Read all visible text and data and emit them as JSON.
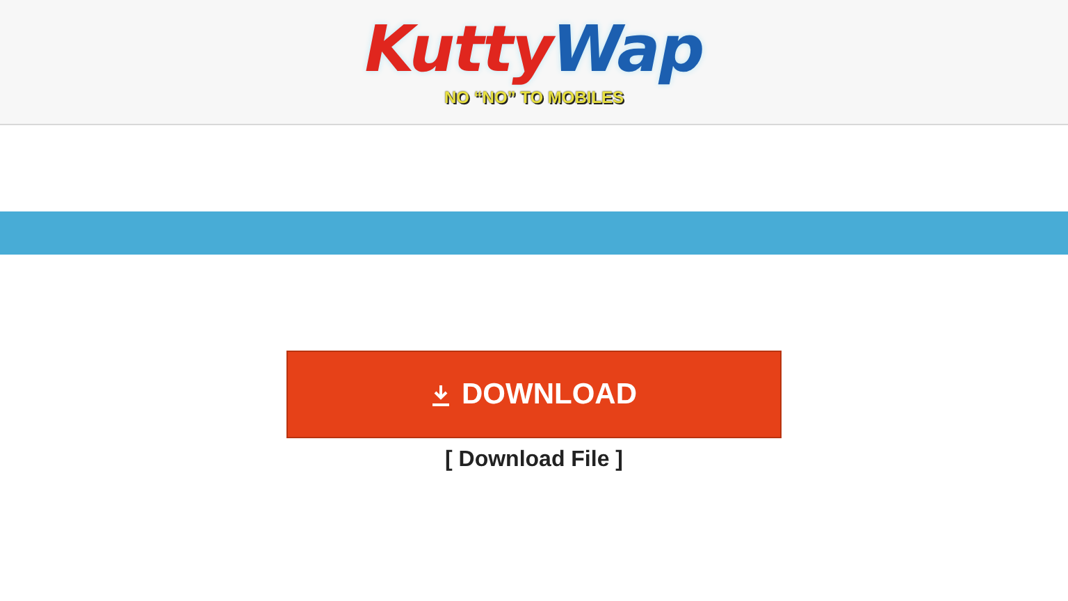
{
  "header": {
    "logo": {
      "first": "Kutty",
      "second": "Wap"
    },
    "tagline": "NO “NO” TO MOBILES"
  },
  "download_button": {
    "label": "DOWNLOAD"
  },
  "download_link": "[ Download File ]"
}
